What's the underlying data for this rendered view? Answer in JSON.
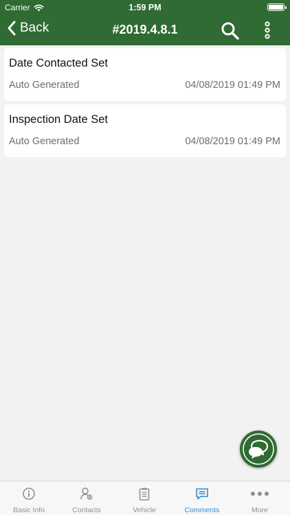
{
  "status_bar": {
    "carrier": "Carrier",
    "time": "1:59 PM"
  },
  "nav": {
    "back_label": "Back",
    "title": "#2019.4.8.1"
  },
  "comments": [
    {
      "title": "Date Contacted Set",
      "source": "Auto Generated",
      "timestamp": "04/08/2019 01:49 PM"
    },
    {
      "title": "Inspection Date Set",
      "source": "Auto Generated",
      "timestamp": "04/08/2019 01:49 PM"
    }
  ],
  "tabs": [
    {
      "label": "Basic Info",
      "icon": "info-icon"
    },
    {
      "label": "Contacts",
      "icon": "contacts-icon"
    },
    {
      "label": "Vehicle",
      "icon": "clipboard-icon"
    },
    {
      "label": "Comments",
      "icon": "comment-icon",
      "active": true
    },
    {
      "label": "More",
      "icon": "ellipsis-icon"
    }
  ],
  "colors": {
    "brand_green": "#2f6b33",
    "active_tab": "#2d8bd6",
    "inactive_tab": "#8e8e93",
    "background": "#f2f2f2"
  }
}
